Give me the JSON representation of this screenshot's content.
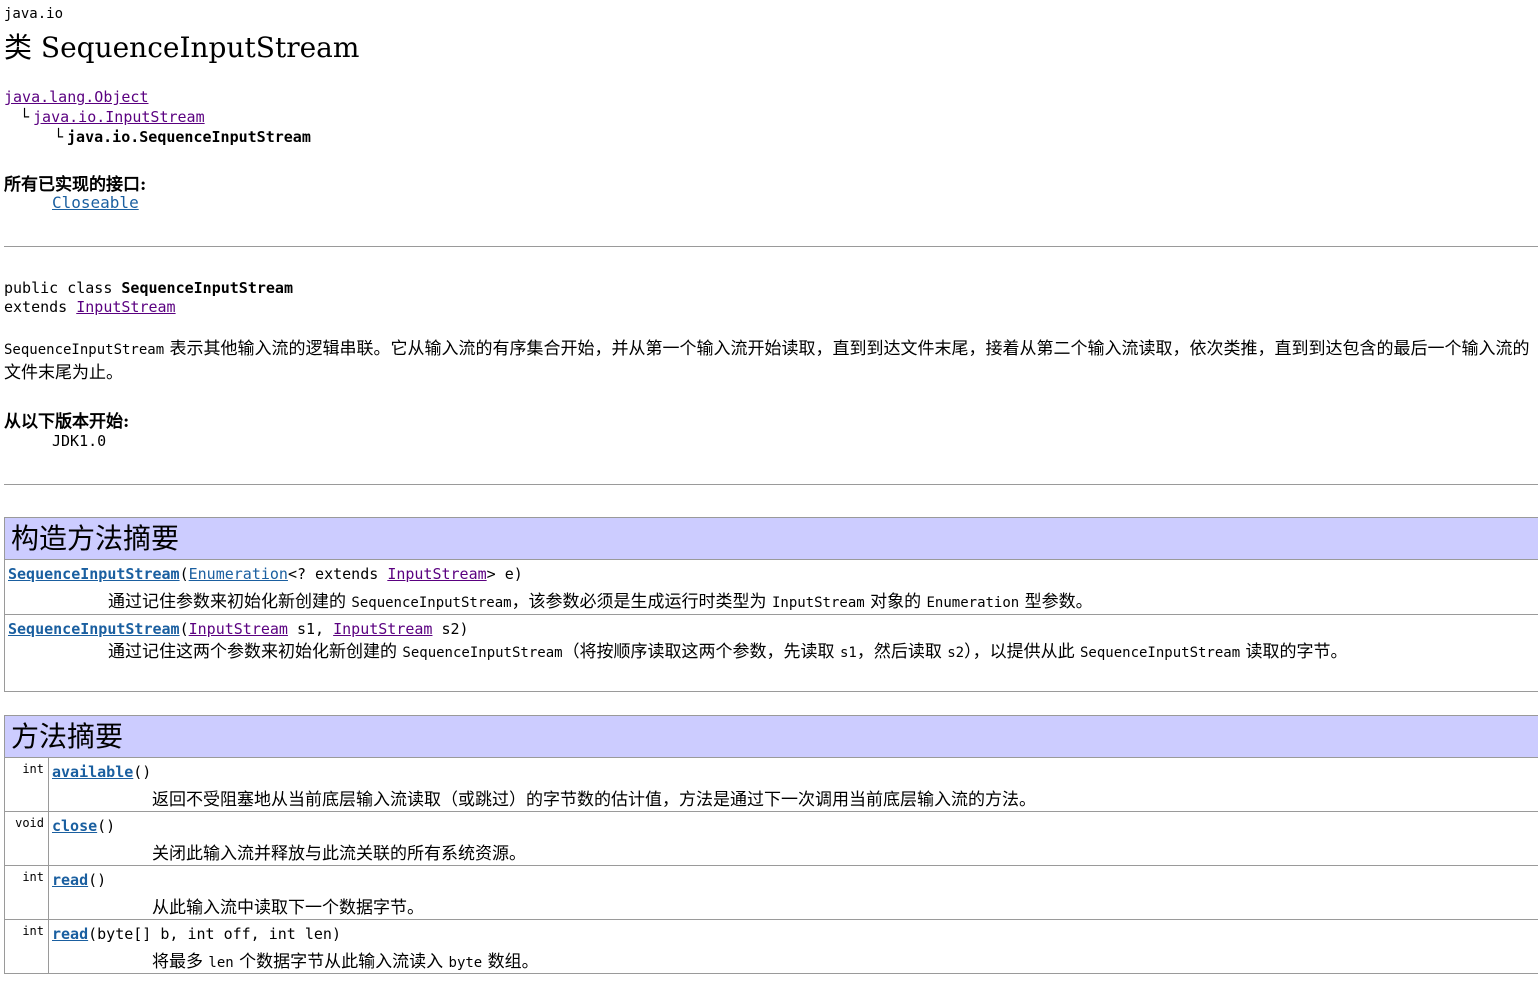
{
  "package": "java.io",
  "title": "类 SequenceInputStream",
  "hierarchy": {
    "root": "java.lang.Object",
    "parent": "java.io.InputStream",
    "self": "java.io.SequenceInputStream"
  },
  "implemented": {
    "heading": "所有已实现的接口:",
    "value": "Closeable"
  },
  "declaration": {
    "modifiers": "public class ",
    "name": "SequenceInputStream",
    "extends_kw": "extends ",
    "extends_name": "InputStream"
  },
  "description": {
    "code": "SequenceInputStream",
    "text": " 表示其他输入流的逻辑串联。它从输入流的有序集合开始，并从第一个输入流开始读取，直到到达文件末尾，接着从第二个输入流读取，依次类推，直到到达包含的最后一个输入流的文件末尾为止。"
  },
  "since": {
    "heading": "从以下版本开始:",
    "value": "JDK1.0"
  },
  "constructor_summary": {
    "heading": "构造方法摘要",
    "rows": [
      {
        "name": "SequenceInputStream",
        "p_open": "(",
        "p1_type": "Enumeration",
        "p1_rest": "<? extends ",
        "p1_type2": "InputStream",
        "p1_end": "> e)",
        "desc_a": "通过记住参数来初始化新创建的 ",
        "desc_code1": "SequenceInputStream",
        "desc_b": "，该参数必须是生成运行时类型为 ",
        "desc_code2": "InputStream",
        "desc_c": " 对象的 ",
        "desc_code3": "Enumeration",
        "desc_d": " 型参数。"
      },
      {
        "name": "SequenceInputStream",
        "p_open": "(",
        "p1_type": "InputStream",
        "p1_rest": " s1, ",
        "p2_type": "InputStream",
        "p2_rest": " s2)",
        "desc_a": "通过记住这两个参数来初始化新创建的 ",
        "desc_code1": "SequenceInputStream",
        "desc_b": "（将按顺序读取这两个参数，先读取 ",
        "desc_code2": "s1",
        "desc_c": "，然后读取 ",
        "desc_code3": "s2",
        "desc_d": "），以提供从此 ",
        "desc_code4": "SequenceInputStream",
        "desc_e": " 读取的字节。"
      }
    ]
  },
  "method_summary": {
    "heading": "方法摘要",
    "rows": [
      {
        "type": "int",
        "name": "available",
        "params": "()",
        "desc_a": "返回不受阻塞地从当前底层输入流读取（或跳过）的字节数的估计值，方法是通过下一次调用当前底层输入流的方法。",
        "desc_code": "",
        "desc_b": ""
      },
      {
        "type": "void",
        "name": "close",
        "params": "()",
        "desc_a": "关闭此输入流并释放与此流关联的所有系统资源。",
        "desc_code": "",
        "desc_b": ""
      },
      {
        "type": "int",
        "name": "read",
        "params": "()",
        "desc_a": "从此输入流中读取下一个数据字节。",
        "desc_code": "",
        "desc_b": ""
      },
      {
        "type": "int",
        "name": "read",
        "params": "(byte[] b, int off, int len)",
        "desc_a": "将最多 ",
        "desc_code": "len",
        "desc_b": " 个数据字节从此输入流读入 ",
        "desc_code2": "byte",
        "desc_c": " 数组。"
      }
    ]
  }
}
